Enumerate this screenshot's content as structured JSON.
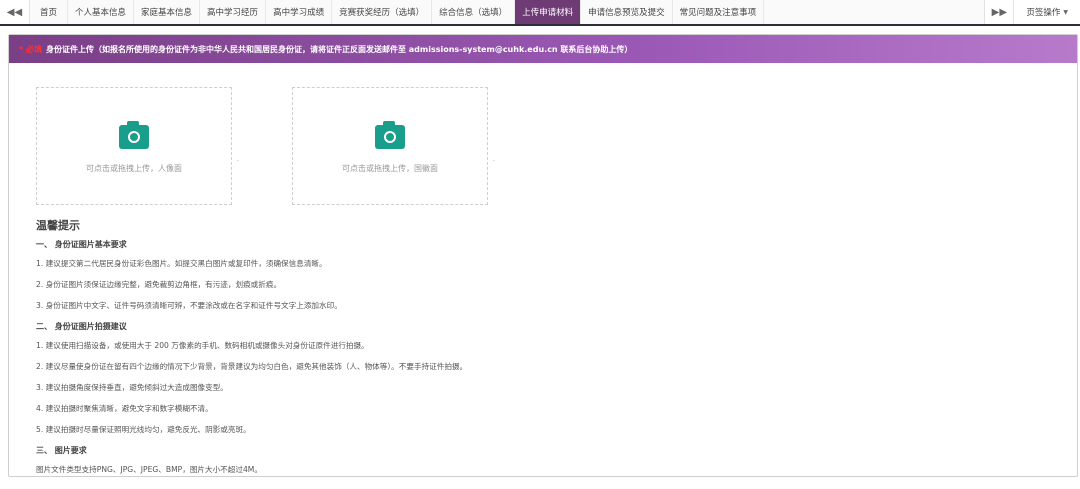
{
  "tabbar": {
    "left_arrow": "◀◀",
    "right_arrow": "▶▶",
    "tabs": [
      {
        "label": "首页"
      },
      {
        "label": "个人基本信息"
      },
      {
        "label": "家庭基本信息"
      },
      {
        "label": "高中学习经历"
      },
      {
        "label": "高中学习成绩"
      },
      {
        "label": "竞赛获奖经历（选填）"
      },
      {
        "label": "综合信息（选填）"
      },
      {
        "label": "上传申请材料",
        "active": true
      },
      {
        "label": "申请信息预览及提交"
      },
      {
        "label": "常见问题及注意事项"
      }
    ],
    "page_ops": "页签操作",
    "active_color": "#6e3b75"
  },
  "panel": {
    "required_mark": "* 必填",
    "header_text": "身份证件上传（如报名所使用的身份证件为非中华人民共和国居民身份证，请将证件正反面发送邮件至 admissions-system@cuhk.edu.cn 联系后台协助上传）",
    "header_gradient": [
      "#7a3f86",
      "#b77acb"
    ],
    "uploads": [
      {
        "icon": "camera-icon",
        "text": "可点击或拖拽上传，人像面"
      },
      {
        "icon": "camera-icon",
        "text": "可点击或拖拽上传，国徽面"
      }
    ],
    "icon_color": "#189e8b"
  },
  "tips": {
    "title": "温馨提示",
    "sections": [
      {
        "heading": "一、 身份证图片基本要求",
        "items": [
          "1. 建议提交第二代居民身份证彩色图片。如提交黑白图片或复印件，须确保信息清晰。",
          "2. 身份证图片须保证边缘完整，避免裁剪边角框，有污迹，划痕或折痕。",
          "3. 身份证图片中文字、证件号码须清晰可辨，不要涂改或在名字和证件号文字上添加水印。"
        ]
      },
      {
        "heading": "二、 身份证图片拍摄建议",
        "items": [
          "1. 建议使用扫描设备，或使用大于 200 万像素的手机、数码相机或摄像头对身份证原件进行拍摄。",
          "2. 建议尽量使身份证在留有四个边缘的情况下少背景，背景建议为均匀白色，避免其他装饰（人、物体等）。不要手持证件拍摄。",
          "3. 建议拍摄角度保持垂直，避免倾斜过大造成图像变型。",
          "4. 建议拍摄时聚焦清晰，避免文字和数字模糊不清。",
          "5. 建议拍摄时尽量保证照明光线均匀，避免反光、阴影或亮斑。"
        ]
      },
      {
        "heading": "三、 图片要求",
        "items": [
          "图片文件类型支持PNG、JPG、JPEG、BMP，图片大小不超过4M。"
        ]
      }
    ]
  }
}
